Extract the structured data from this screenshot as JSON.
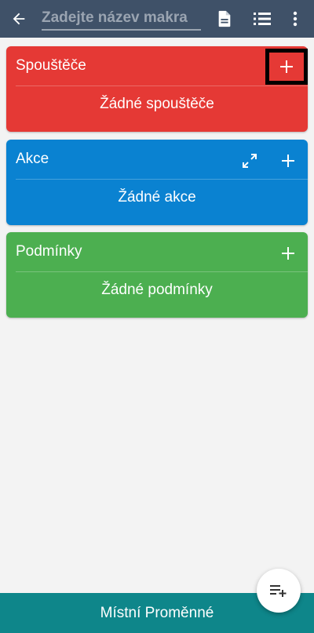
{
  "toolbar": {
    "name_placeholder": "Zadejte název makra",
    "name_value": "",
    "back_icon": "arrow-left-icon",
    "description_icon": "document-icon",
    "list_icon": "list-icon",
    "more_icon": "more-vert-icon"
  },
  "cards": {
    "triggers": {
      "title": "Spouštěče",
      "empty": "Žádné spouštěče",
      "color": "#e53935"
    },
    "actions": {
      "title": "Akce",
      "empty": "Žádné akce",
      "color": "#0a82d1"
    },
    "conditions": {
      "title": "Podmínky",
      "empty": "Žádné podmínky",
      "color": "#4caf50"
    }
  },
  "bottom": {
    "label": "Místní Proměnné"
  },
  "colors": {
    "header_bg": "#3f5168",
    "bottom_bg": "#0e868a",
    "page_bg": "#f3f3f3"
  }
}
